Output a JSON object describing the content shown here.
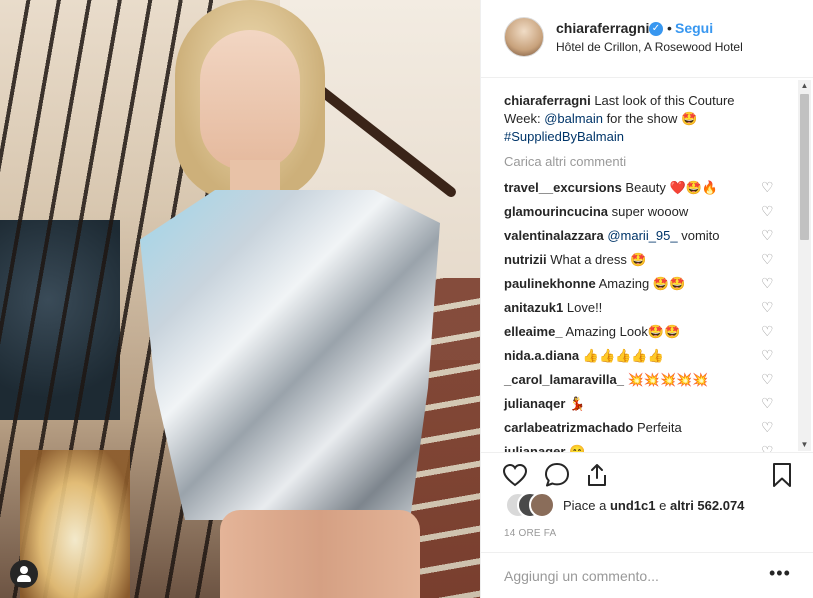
{
  "header": {
    "username": "chiaraferragni",
    "separator": "•",
    "follow_label": "Segui",
    "location": "Hôtel de Crillon, A Rosewood Hotel",
    "verified_icon": "verified-badge-icon"
  },
  "caption": {
    "username": "chiaraferragni",
    "text_1": "Last look of this Couture Week: ",
    "mention": "@balmain",
    "text_2": " for the show 🤩",
    "hashtag": "#SuppliedByBalmain"
  },
  "load_more": "Carica altri commenti",
  "comments": [
    {
      "user": "travel__excursions",
      "text": "Beauty ❤️🤩🔥"
    },
    {
      "user": "glamourincucina",
      "text": "super wooow"
    },
    {
      "user": "valentinalazzara",
      "text": "@marii_95_ vomito",
      "mention": "@marii_95_",
      "rest": " vomito"
    },
    {
      "user": "nutrizii",
      "text": "What a dress 🤩"
    },
    {
      "user": "paulinekhonne",
      "text": "Amazing 🤩🤩"
    },
    {
      "user": "anitazuk1",
      "text": "Love!!"
    },
    {
      "user": "elleaime_",
      "text": "Amazing Look🤩🤩"
    },
    {
      "user": "nida.a.diana",
      "text": "👍👍👍👍👍"
    },
    {
      "user": "_carol_lamaravilla_",
      "text": "💥💥💥💥💥"
    },
    {
      "user": "julianaqer",
      "text": "💃"
    },
    {
      "user": "carlabeatrizmachado",
      "text": "Perfeita"
    },
    {
      "user": "julianaqer",
      "text": "😁"
    }
  ],
  "likes": {
    "prefix": "Piace a ",
    "user": "und1c1",
    "middle": " e ",
    "count": "altri 562.074"
  },
  "timestamp": "14 ORE FA",
  "add_comment": {
    "placeholder": "Aggiungi un commento...",
    "more_label": "•••"
  },
  "colors": {
    "accent": "#3897f0",
    "link": "#003569",
    "muted": "#999999",
    "text": "#262626"
  },
  "icons": {
    "like": "heart-icon",
    "comment": "comment-icon",
    "share": "share-icon",
    "save": "bookmark-icon",
    "user_tag": "user-tag-icon"
  }
}
